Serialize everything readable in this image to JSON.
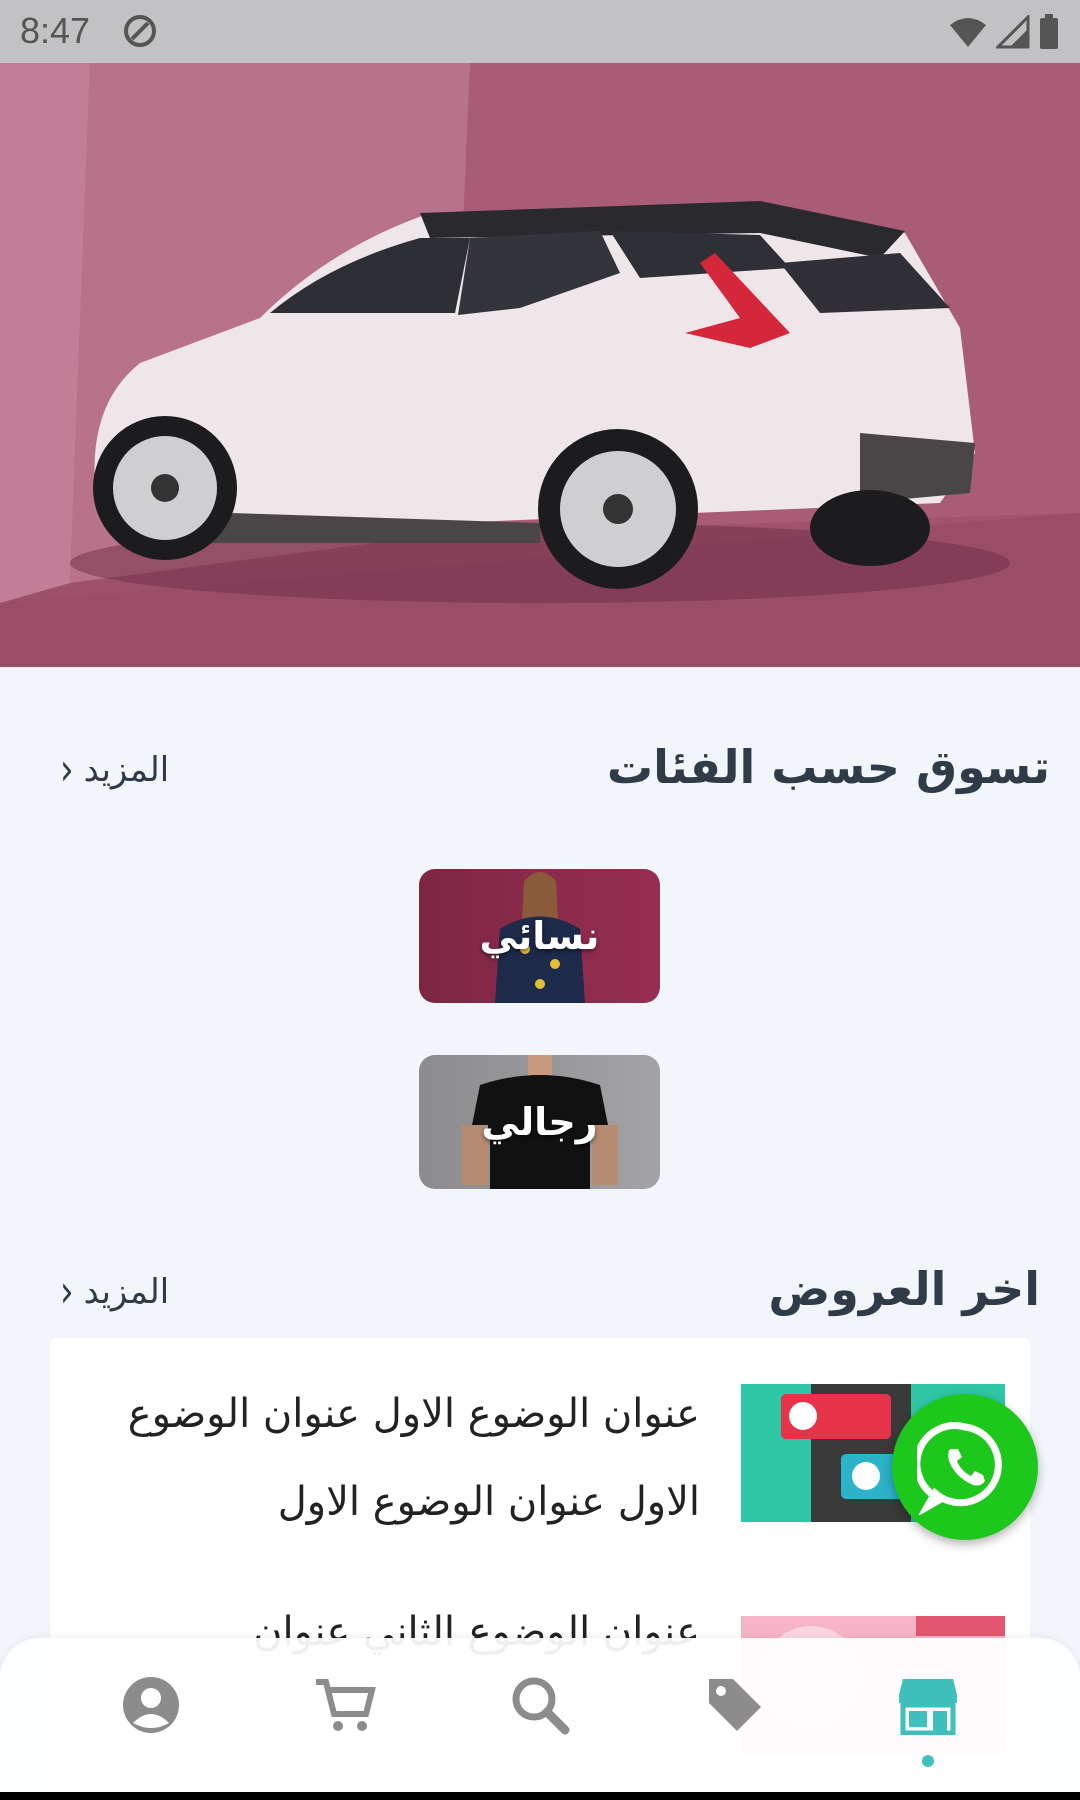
{
  "status_bar": {
    "time": "8:47",
    "icons": [
      "dnd-icon",
      "wifi-icon",
      "signal-icon",
      "battery-icon"
    ]
  },
  "hero": {
    "image": "car-banner"
  },
  "categories_section": {
    "title": "تسوق حسب الفئات",
    "more_label": "المزيد",
    "items": [
      {
        "label": "نسائي"
      },
      {
        "label": "رجالي"
      }
    ]
  },
  "offers_section": {
    "title": "اخر العروض",
    "more_label": "المزيد",
    "items": [
      {
        "title": "عنوان الوضوع الاول عنوان الوضوع الاول عنوان الوضوع الاول"
      },
      {
        "title": "عنوان الوضوع الثاني عنوان"
      }
    ]
  },
  "bottom_nav": {
    "items": [
      "profile-icon",
      "cart-icon",
      "search-icon",
      "tag-icon",
      "store-icon"
    ],
    "active": "store-icon"
  },
  "colors": {
    "accent": "#3fc0bd",
    "whatsapp": "#1ec71b",
    "background": "#f2f6fb"
  }
}
